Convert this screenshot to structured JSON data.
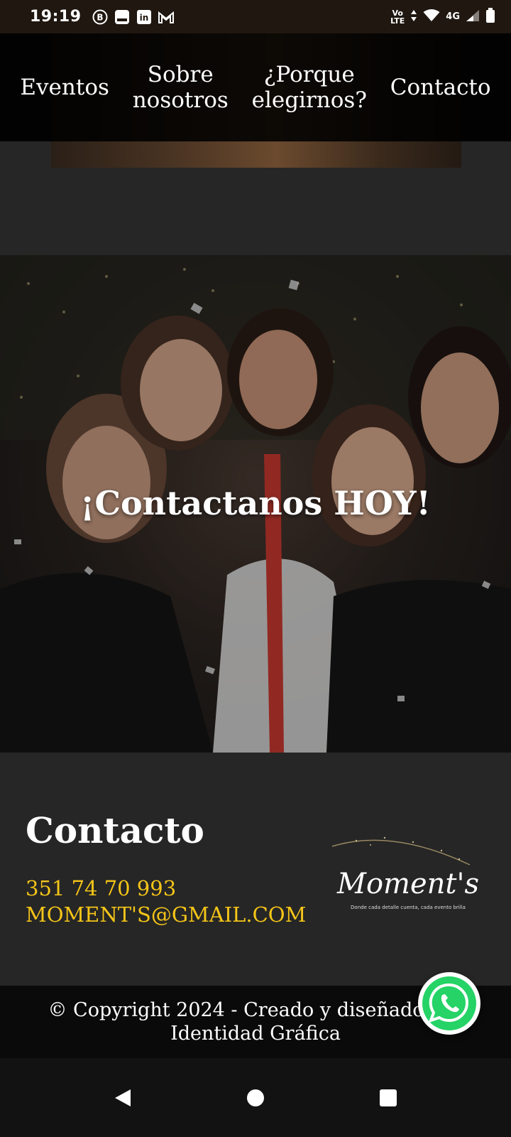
{
  "status_bar": {
    "time": "19:19",
    "apps": [
      "b-icon",
      "app-icon",
      "linkedin-icon",
      "gmail-icon"
    ],
    "volte_top": "Vo",
    "volte_bottom": "LTE",
    "network": "4G"
  },
  "nav": {
    "items": [
      {
        "line1": "Eventos",
        "line2": ""
      },
      {
        "line1": "Sobre",
        "line2": "nosotros"
      },
      {
        "line1": "¿Porque",
        "line2": "elegirnos?"
      },
      {
        "line1": "Contacto",
        "line2": ""
      }
    ]
  },
  "hero": {
    "title": "¡Contactanos HOY!"
  },
  "contact": {
    "title": "Contacto",
    "phone": "351 74 70 993",
    "email": "MOMENT'S@GMAIL.COM",
    "logo_text": "Moment's",
    "logo_tagline": "Donde cada detalle cuenta, cada evento brilla"
  },
  "footer": {
    "line1": "© Copyright 2024 - Creado y diseñado por",
    "line2": "Identidad Gráfica"
  },
  "colors": {
    "accent": "#f5c518",
    "background": "#262626",
    "footer": "#0a0a0a",
    "whatsapp": "#25d366"
  }
}
